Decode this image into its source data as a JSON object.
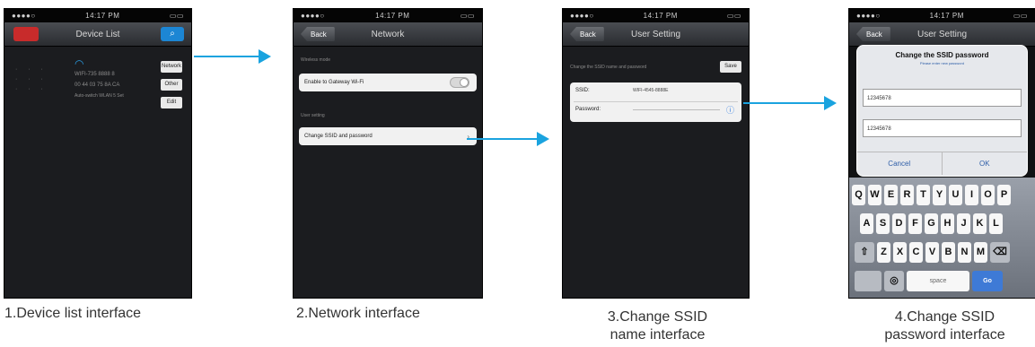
{
  "colors": {
    "arrow": "#1aa3df",
    "phone_bg": "#111214",
    "nav": "#2a2c30"
  },
  "statusbar": {
    "time": "14:17 PM"
  },
  "phones": [
    {
      "nav_title": "Device List",
      "caption": "1.Device list interface"
    },
    {
      "nav_title": "Network",
      "back": "Back",
      "caption": "2.Network interface"
    },
    {
      "nav_title": "User Setting",
      "back": "Back",
      "caption_line1": "3.Change SSID",
      "caption_line2": "name interface"
    },
    {
      "nav_title": "User Setting",
      "back": "Back",
      "caption_line1": "4.Change SSID",
      "caption_line2": "password interface"
    }
  ],
  "phone1": {
    "btn_network": "Network",
    "btn_other": "Other",
    "btn_third": "Edit",
    "device_id": "WIFI-735 8888 8",
    "device_mac": "00 44 03 75 8A CA",
    "device_meta": "Auto-switch WLAN 5 Set"
  },
  "phone2": {
    "section1": "Wireless mode",
    "row1": "Enable to Gateway Wi-Fi",
    "section2": "User setting",
    "row2": "Change SSID and password"
  },
  "phone3": {
    "header": "Change the SSID name and password",
    "save": "Save",
    "ssid_label": "SSID:",
    "ssid_value": "WIFI-4545-8888E",
    "password_label": "Password:"
  },
  "phone4": {
    "title": "Change the SSID password",
    "subtitle": "Please enter new password",
    "input1": "12345678",
    "input2": "12345678",
    "cancel": "Cancel",
    "ok": "OK",
    "row1": [
      "Q",
      "W",
      "E",
      "R",
      "T",
      "Y",
      "U",
      "I",
      "O",
      "P"
    ],
    "row2": [
      "A",
      "S",
      "D",
      "F",
      "G",
      "H",
      "J",
      "K",
      "L"
    ],
    "row3": [
      "Z",
      "X",
      "C",
      "V",
      "B",
      "N",
      "M"
    ],
    "space": "space",
    "go": "Go"
  }
}
